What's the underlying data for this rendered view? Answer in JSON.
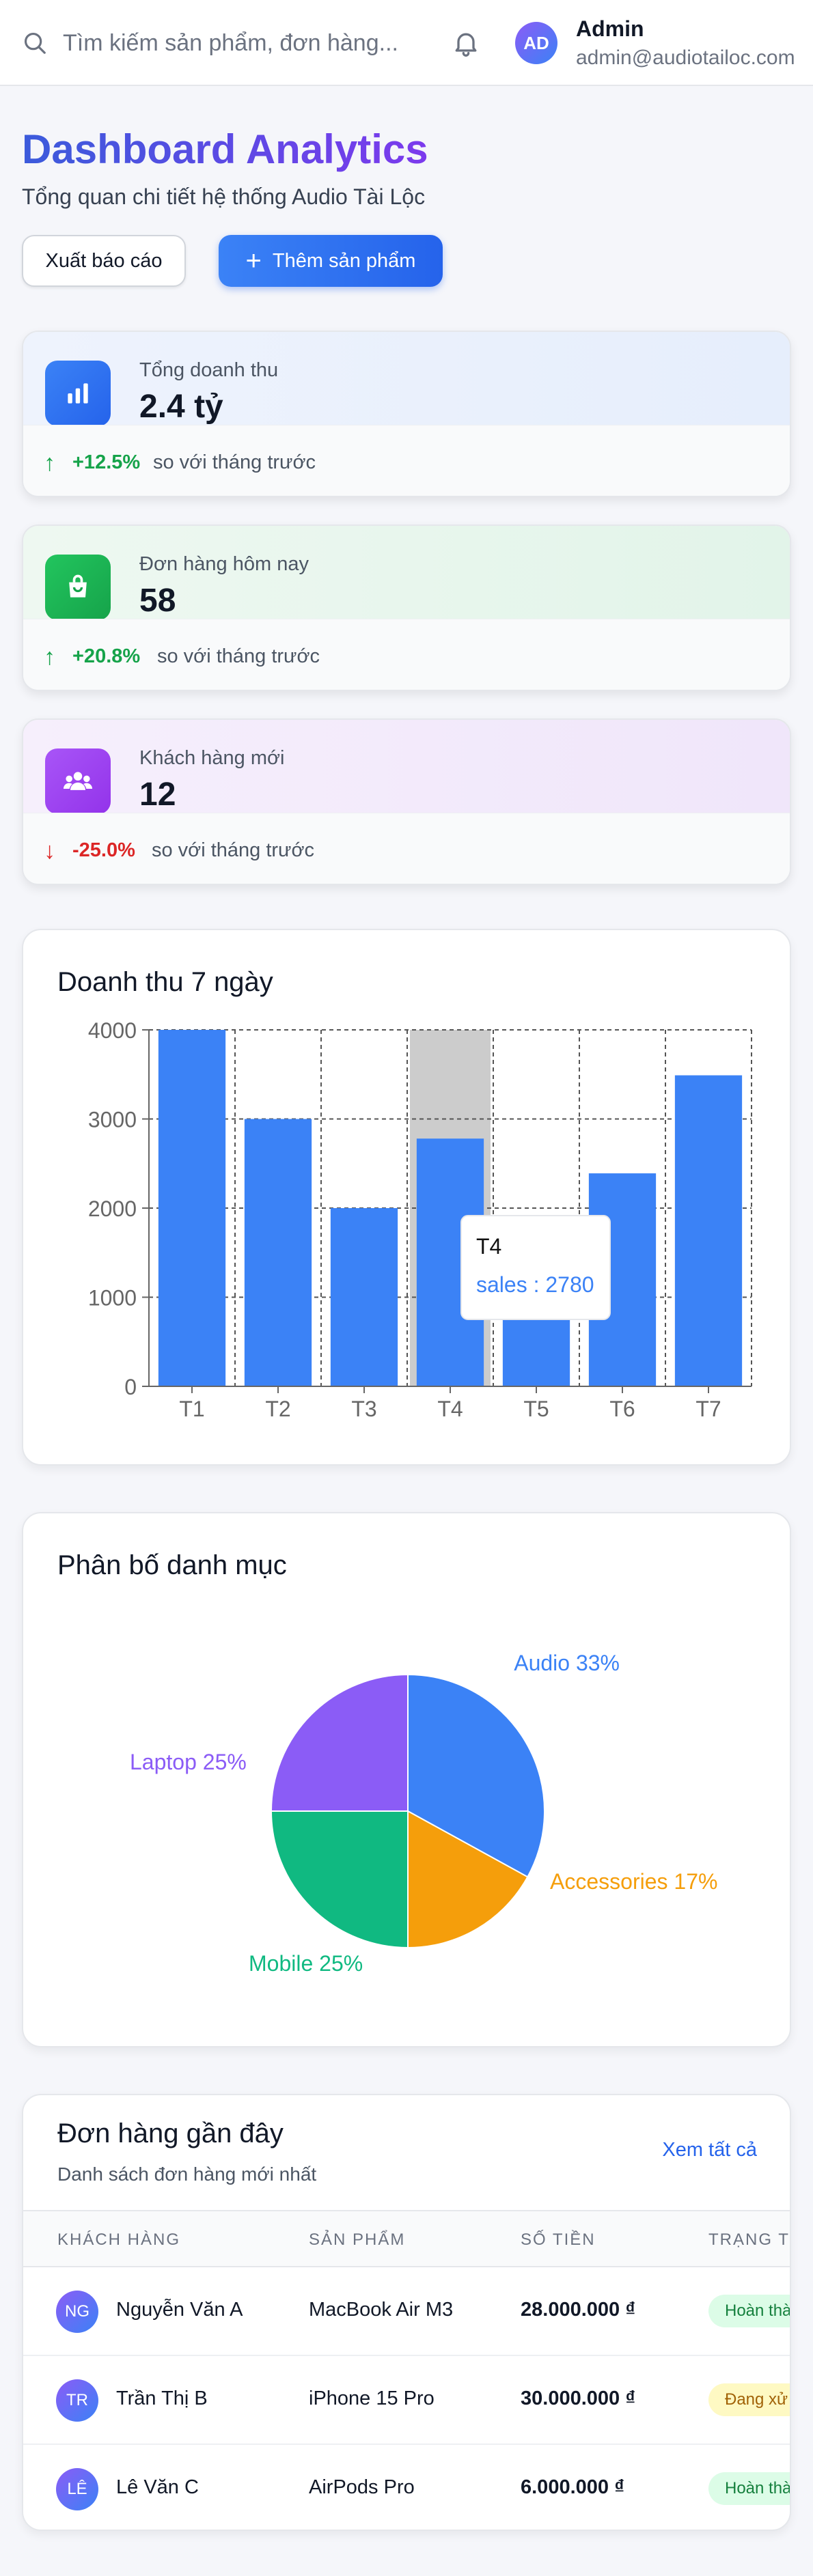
{
  "header": {
    "search_placeholder": "Tìm kiếm sản phẩm, đơn hàng...",
    "user_initials": "AD",
    "user_name": "Admin",
    "user_email": "admin@audiotailoc.com"
  },
  "page": {
    "title": "Dashboard Analytics",
    "subtitle": "Tổng quan chi tiết hệ thống Audio Tài Lộc",
    "export_label": "Xuất báo cáo",
    "add_label": "Thêm sản phẩm"
  },
  "stats": [
    {
      "label": "Tổng doanh thu",
      "value": "2.4 tỷ",
      "change": "+12.5%",
      "direction": "up",
      "compare": "so với tháng trước",
      "icon": "bar-chart-icon",
      "color": "#2563eb",
      "tint": "#e8effd"
    },
    {
      "label": "Đơn hàng hôm nay",
      "value": "58",
      "change": "+20.8%",
      "direction": "up",
      "compare": "so với tháng trước",
      "icon": "shopping-bag-icon",
      "color": "#16a34a",
      "tint": "#e6f6ec"
    },
    {
      "label": "Khách hàng mới",
      "value": "12",
      "change": "-25.0%",
      "direction": "down",
      "compare": "so với tháng trước",
      "icon": "users-icon",
      "color": "#9333ea",
      "tint": "#f3e8fb"
    }
  ],
  "revenue_panel": {
    "title": "Doanh thu 7 ngày"
  },
  "category_panel": {
    "title": "Phân bố danh mục"
  },
  "chart_data": [
    {
      "type": "bar",
      "categories": [
        "T1",
        "T2",
        "T3",
        "T4",
        "T5",
        "T6",
        "T7"
      ],
      "series": [
        {
          "name": "sales",
          "values": [
            4000,
            3000,
            2000,
            2780,
            1890,
            2390,
            3490
          ]
        }
      ],
      "ylim": [
        0,
        4000
      ],
      "yticks": [
        0,
        1000,
        2000,
        3000,
        4000
      ],
      "grid": true,
      "bar_color": "#3b82f6",
      "highlight_category": "T4",
      "tooltip": {
        "title": "T4",
        "label": "sales : 2780"
      }
    },
    {
      "type": "pie",
      "slices": [
        {
          "label": "Audio 33%",
          "value": 33,
          "color": "#3b82f6"
        },
        {
          "label": "Accessories 17%",
          "value": 17,
          "color": "#f59e0b"
        },
        {
          "label": "Mobile 25%",
          "value": 25,
          "color": "#10b981"
        },
        {
          "label": "Laptop 25%",
          "value": 25,
          "color": "#8b5cf6"
        }
      ]
    }
  ],
  "orders": {
    "title": "Đơn hàng gần đây",
    "subtitle": "Danh sách đơn hàng mới nhất",
    "view_all": "Xem tất cả",
    "columns": [
      "KHÁCH HÀNG",
      "SẢN PHẨM",
      "SỐ TIỀN",
      "TRẠNG THÁI"
    ],
    "rows": [
      {
        "initials": "NG",
        "customer": "Nguyễn Văn A",
        "product": "MacBook Air M3",
        "amount": "28.000.000 ₫",
        "status": "Hoàn thành",
        "status_color": "#15803d",
        "status_bg": "#dcfce7"
      },
      {
        "initials": "TR",
        "customer": "Trần Thị B",
        "product": "iPhone 15 Pro",
        "amount": "30.000.000 ₫",
        "status": "Đang xử lý",
        "status_color": "#a16207",
        "status_bg": "#fef9c3"
      },
      {
        "initials": "LÊ",
        "customer": "Lê Văn C",
        "product": "AirPods Pro",
        "amount": "6.000.000 ₫",
        "status": "Hoàn thành",
        "status_color": "#15803d",
        "status_bg": "#dcfce7"
      }
    ]
  }
}
